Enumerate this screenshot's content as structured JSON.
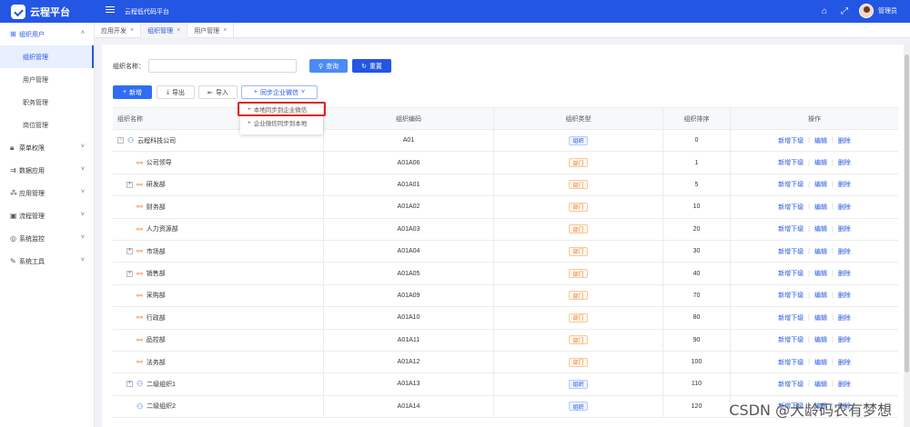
{
  "app": {
    "brand": "云程平台",
    "platform_title": "云程低代码平台",
    "user": "管理员"
  },
  "header_icons": [
    "home-icon",
    "fullscreen-icon"
  ],
  "sidebar": {
    "groups": [
      {
        "label": "组织用户",
        "icon": "org-user-icon",
        "expanded": true,
        "items": [
          {
            "label": "组织管理"
          },
          {
            "label": "用户管理"
          },
          {
            "label": "职务管理"
          },
          {
            "label": "岗位管理"
          }
        ]
      },
      {
        "label": "菜单权限",
        "icon": "lock-icon"
      },
      {
        "label": "数据应用",
        "icon": "data-icon"
      },
      {
        "label": "应用管理",
        "icon": "app-icon"
      },
      {
        "label": "流程管理",
        "icon": "flow-icon"
      },
      {
        "label": "系统监控",
        "icon": "monitor-icon"
      },
      {
        "label": "系统工具",
        "icon": "tool-icon"
      }
    ]
  },
  "tabs": [
    {
      "label": "应用开发"
    },
    {
      "label": "组织管理"
    },
    {
      "label": "用户管理"
    }
  ],
  "search": {
    "label": "组织名称：",
    "value": "",
    "query_label": "查询",
    "reset_label": "重置"
  },
  "toolbar": {
    "add_label": "新增",
    "export_label": "导出",
    "import_label": "导入",
    "sync_label": "同步企业微信"
  },
  "sync_menu": [
    "本地同步到企业微信",
    "企业微信同步到本地"
  ],
  "table": {
    "columns": [
      "组织名称",
      "组织编码",
      "组织类型",
      "组织排序",
      "操作"
    ],
    "actions": [
      "新增下级",
      "编辑",
      "删除"
    ],
    "rows": [
      {
        "name": "云程科技公司",
        "code": "A01",
        "type": "组织",
        "sort": "0",
        "expander": "-",
        "kind": "company",
        "indent": 0
      },
      {
        "name": "公司领导",
        "code": "A01A06",
        "type": "部门",
        "sort": "1",
        "expander": "",
        "kind": "dept",
        "indent": 1
      },
      {
        "name": "研发部",
        "code": "A01A01",
        "type": "部门",
        "sort": "5",
        "expander": "+",
        "kind": "dept",
        "indent": 1
      },
      {
        "name": "财务部",
        "code": "A01A02",
        "type": "部门",
        "sort": "10",
        "expander": "",
        "kind": "dept",
        "indent": 1
      },
      {
        "name": "人力资源部",
        "code": "A01A03",
        "type": "部门",
        "sort": "20",
        "expander": "",
        "kind": "dept",
        "indent": 1
      },
      {
        "name": "市场部",
        "code": "A01A04",
        "type": "部门",
        "sort": "30",
        "expander": "+",
        "kind": "dept",
        "indent": 1
      },
      {
        "name": "销售部",
        "code": "A01A05",
        "type": "部门",
        "sort": "40",
        "expander": "+",
        "kind": "dept",
        "indent": 1
      },
      {
        "name": "采购部",
        "code": "A01A09",
        "type": "部门",
        "sort": "70",
        "expander": "",
        "kind": "dept",
        "indent": 1
      },
      {
        "name": "行政部",
        "code": "A01A10",
        "type": "部门",
        "sort": "80",
        "expander": "",
        "kind": "dept",
        "indent": 1
      },
      {
        "name": "品控部",
        "code": "A01A11",
        "type": "部门",
        "sort": "90",
        "expander": "",
        "kind": "dept",
        "indent": 1
      },
      {
        "name": "法务部",
        "code": "A01A12",
        "type": "部门",
        "sort": "100",
        "expander": "",
        "kind": "dept",
        "indent": 1
      },
      {
        "name": "二级组织1",
        "code": "A01A13",
        "type": "组织",
        "sort": "110",
        "expander": "+",
        "kind": "company",
        "indent": 1
      },
      {
        "name": "二级组织2",
        "code": "A01A14",
        "type": "组织",
        "sort": "120",
        "expander": "",
        "kind": "company",
        "indent": 1
      }
    ]
  },
  "watermark": "CSDN @大龄码农有梦想"
}
